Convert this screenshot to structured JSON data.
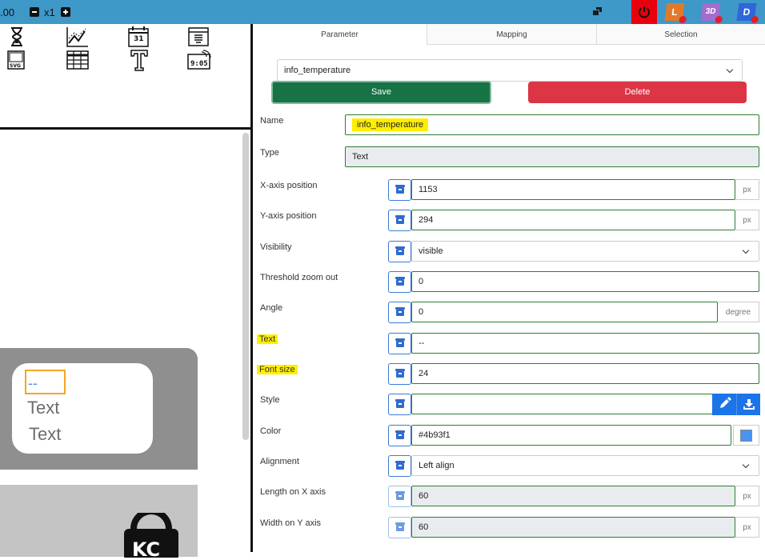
{
  "topbar": {
    "zoom_value": ".00",
    "zoom_multiplier": "x1",
    "power_color": "#e8000c",
    "apps": [
      {
        "name": "L",
        "color": "#e07a2a"
      },
      {
        "name": "3D",
        "color": "#a36ccf"
      },
      {
        "name": "D",
        "color": "#2f66d8"
      }
    ]
  },
  "toolbox": {
    "icons": [
      "hourglass-icon",
      "line-chart-icon",
      "calendar-icon",
      "list-panel-icon",
      "svg-icon",
      "table-icon",
      "text-tool-icon",
      "clock-display-icon"
    ],
    "svg_label": "SVG",
    "clock_label": "9:05"
  },
  "canvas": {
    "selected_text": "--",
    "card_text_1": "Text",
    "card_text_2": "Text",
    "lock_label": "KC"
  },
  "panel": {
    "tabs": [
      "Parameter",
      "Mapping",
      "Selection"
    ],
    "element_select": "info_temperature",
    "save_label": "Save",
    "delete_label": "Delete",
    "fields": {
      "name": {
        "label": "Name",
        "value": "info_temperature"
      },
      "type": {
        "label": "Type",
        "value": "Text"
      },
      "x_position": {
        "label": "X-axis position",
        "value": "1153",
        "unit": "px"
      },
      "y_position": {
        "label": "Y-axis position",
        "value": "294",
        "unit": "px"
      },
      "visibility": {
        "label": "Visibility",
        "value": "visible"
      },
      "threshold": {
        "label": "Threshold zoom out",
        "value": "0"
      },
      "angle": {
        "label": "Angle",
        "value": "0",
        "unit": "degree"
      },
      "text": {
        "label": "Text",
        "value": "--"
      },
      "font_size": {
        "label": "Font size",
        "value": "24"
      },
      "style": {
        "label": "Style",
        "value": ""
      },
      "color": {
        "label": "Color",
        "value": "#4b93f1"
      },
      "alignment": {
        "label": "Alignment",
        "value": "Left align"
      },
      "length_x": {
        "label": "Length on X axis",
        "value": "60",
        "unit": "px"
      },
      "width_y": {
        "label": "Width on Y axis",
        "value": "60",
        "unit": "px"
      }
    }
  }
}
